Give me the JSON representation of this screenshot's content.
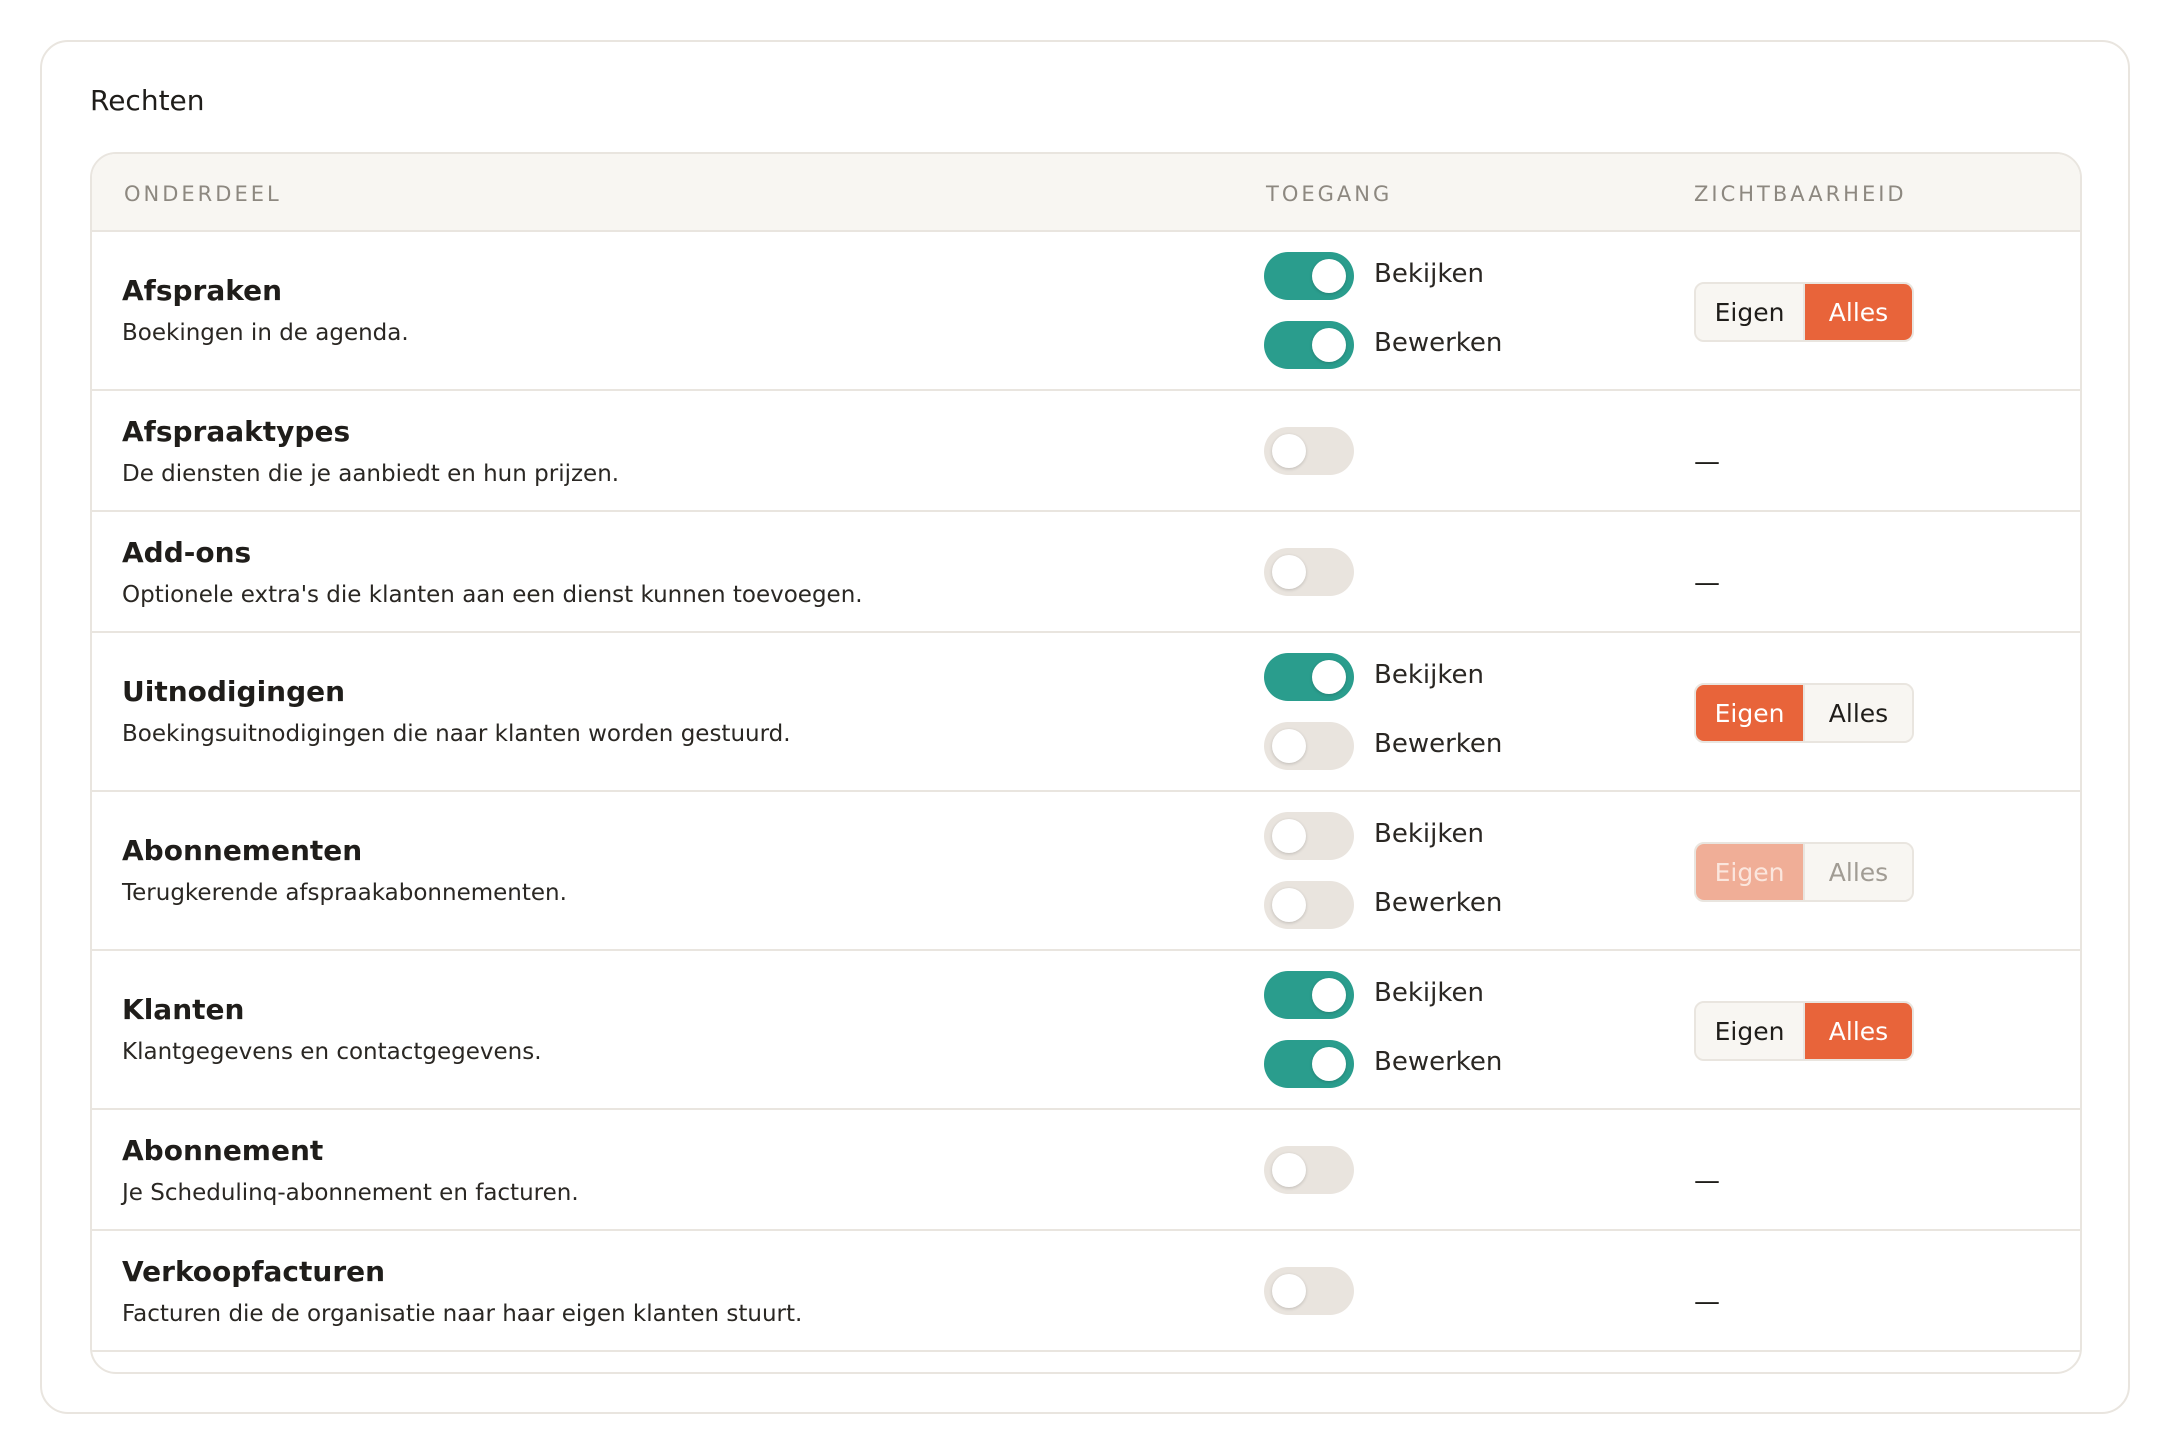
{
  "card": {
    "title": "Rechten"
  },
  "columns": {
    "onderdeel": "ONDERDEEL",
    "toegang": "TOEGANG",
    "zichtbaarheid": "ZICHTBAARHEID"
  },
  "labels": {
    "view": "Bekijken",
    "edit": "Bewerken",
    "own": "Eigen",
    "all": "Alles",
    "none": "—"
  },
  "colors": {
    "toggle_on": "#2a9d8d",
    "toggle_off": "#e9e4de",
    "accent": "#e8643a",
    "border": "#e9e5df",
    "header_bg": "#f8f6f2"
  },
  "rows": [
    {
      "name": "Afspraken",
      "description": "Boekingen in de agenda.",
      "view": true,
      "edit": true,
      "visibility": "Alles"
    },
    {
      "name": "Afspraaktypes",
      "description": "De diensten die je aanbiedt en hun prijzen.",
      "access": false
    },
    {
      "name": "Add-ons",
      "description": "Optionele extra's die klanten aan een dienst kunnen toevoegen.",
      "access": false
    },
    {
      "name": "Uitnodigingen",
      "description": "Boekingsuitnodigingen die naar klanten worden gestuurd.",
      "view": true,
      "edit": false,
      "visibility": "Eigen"
    },
    {
      "name": "Abonnementen",
      "description": "Terugkerende afspraakabonnementen.",
      "view": false,
      "edit": false,
      "visibility": "Eigen",
      "visibility_disabled": true
    },
    {
      "name": "Klanten",
      "description": "Klantgegevens en contactgegevens.",
      "view": true,
      "edit": true,
      "visibility": "Alles"
    },
    {
      "name": "Abonnement",
      "description": "Je Schedulinq-abonnement en facturen.",
      "access": false
    },
    {
      "name": "Verkoopfacturen",
      "description": "Facturen die de organisatie naar haar eigen klanten stuurt.",
      "access": false
    }
  ]
}
